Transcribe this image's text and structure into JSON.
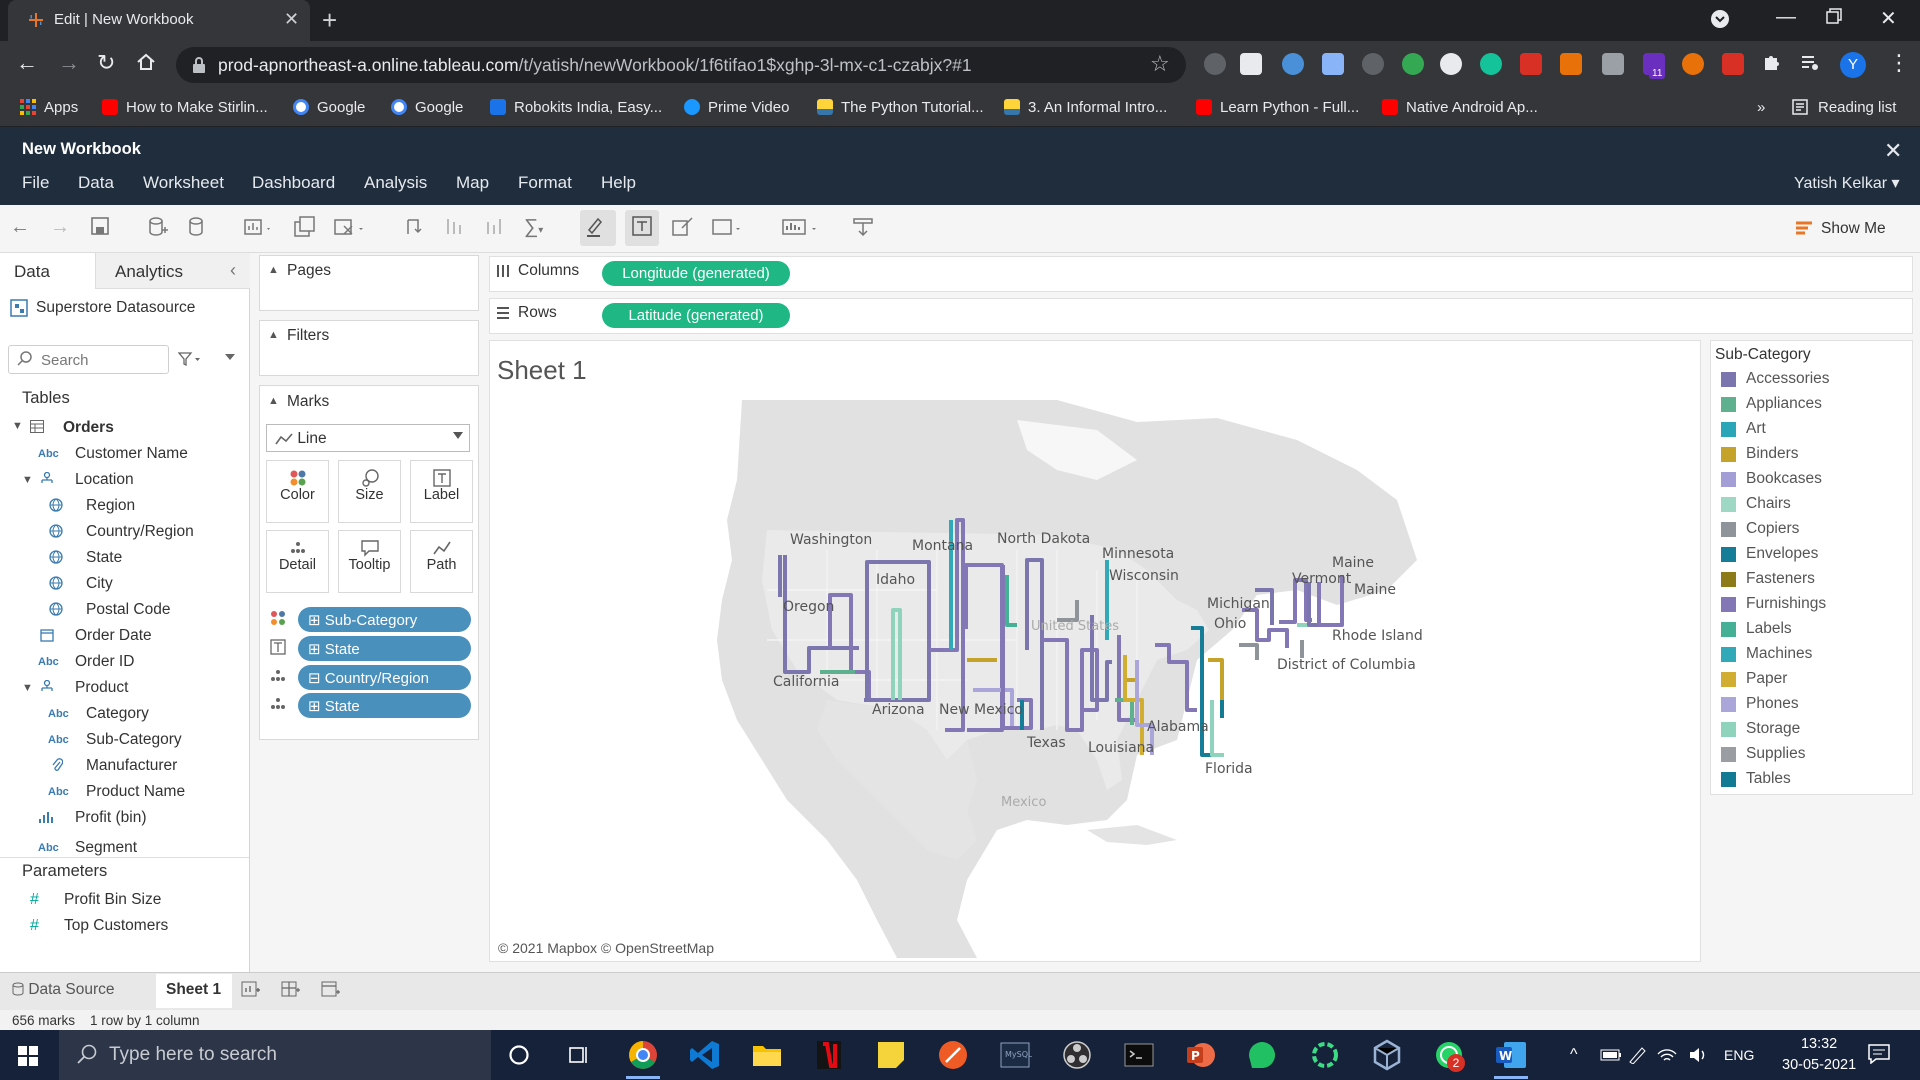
{
  "browser": {
    "tab_title": "Edit | New Workbook",
    "url_host": "prod-apnortheast-a.online.tableau.com",
    "url_path": "/t/yatish/newWorkbook/1f6tifao1$xghp-3l-mx-c1-czabjx?#1",
    "profile_initial": "Y",
    "extensions_badge": "11",
    "bookmarks": [
      "Apps",
      "How to Make Stirlin...",
      "Google",
      "Google",
      "Robokits India, Easy...",
      "Prime Video",
      "The Python Tutorial...",
      "3. An Informal Intro...",
      "Learn Python - Full...",
      "Native Android Ap..."
    ],
    "bookmarks_more": "»",
    "reading_list": "Reading list"
  },
  "tableau": {
    "workbook_title": "New Workbook",
    "menu": [
      "File",
      "Data",
      "Worksheet",
      "Dashboard",
      "Analysis",
      "Map",
      "Format",
      "Help"
    ],
    "user": "Yatish Kelkar ▾",
    "show_me": "Show Me",
    "pane_tabs": {
      "data": "Data",
      "analytics": "Analytics"
    },
    "datasource": "Superstore Datasource",
    "search_placeholder": "Search",
    "tables_header": "Tables",
    "fields": [
      {
        "label": "Orders",
        "type": "table"
      },
      {
        "label": "Customer Name",
        "type": "Abc"
      },
      {
        "label": "Location",
        "type": "hier"
      },
      {
        "label": "Region",
        "type": "geo"
      },
      {
        "label": "Country/Region",
        "type": "geo"
      },
      {
        "label": "State",
        "type": "geo"
      },
      {
        "label": "City",
        "type": "geo"
      },
      {
        "label": "Postal Code",
        "type": "geo"
      },
      {
        "label": "Order Date",
        "type": "date"
      },
      {
        "label": "Order ID",
        "type": "Abc"
      },
      {
        "label": "Product",
        "type": "hier"
      },
      {
        "label": "Category",
        "type": "Abc"
      },
      {
        "label": "Sub-Category",
        "type": "Abc"
      },
      {
        "label": "Manufacturer",
        "type": "clip"
      },
      {
        "label": "Product Name",
        "type": "Abc"
      },
      {
        "label": "Profit (bin)",
        "type": "bin"
      },
      {
        "label": "Segment",
        "type": "Abc"
      }
    ],
    "parameters_header": "Parameters",
    "parameters": [
      "Profit Bin Size",
      "Top Customers"
    ],
    "cards": {
      "pages": "Pages",
      "filters": "Filters",
      "marks": "Marks"
    },
    "mark_type": "Line",
    "mark_buttons": [
      "Color",
      "Size",
      "Label",
      "Detail",
      "Tooltip",
      "Path"
    ],
    "mark_pills": [
      "⊞ Sub-Category",
      "⊞ State",
      "⊟ Country/Region",
      "⊞ State"
    ],
    "columns_label": "Columns",
    "rows_label": "Rows",
    "columns_pill": "Longitude (generated)",
    "rows_pill": "Latitude (generated)",
    "sheet_title": "Sheet 1",
    "map_copyright": "© 2021 Mapbox © OpenStreetMap",
    "map_labels": [
      "Washington",
      "Montana",
      "North Dakota",
      "Minnesota",
      "Wisconsin",
      "Maine",
      "Maine",
      "Vermont",
      "Idaho",
      "Oregon",
      "Michigan",
      "Ohio",
      "Rhode Island",
      "United States",
      "District of Columbia",
      "California",
      "Arizona",
      "New Mexico",
      "Texas",
      "Louisiana",
      "Alabama",
      "Florida",
      "Mexico"
    ],
    "legend_title": "Sub-Category",
    "legend": [
      {
        "label": "Accessories",
        "color": "#7b76ad"
      },
      {
        "label": "Appliances",
        "color": "#5fb08e"
      },
      {
        "label": "Art",
        "color": "#2aa6b8"
      },
      {
        "label": "Binders",
        "color": "#c5a32b"
      },
      {
        "label": "Bookcases",
        "color": "#a39ed6"
      },
      {
        "label": "Chairs",
        "color": "#9ed8c4"
      },
      {
        "label": "Copiers",
        "color": "#8f949a"
      },
      {
        "label": "Envelopes",
        "color": "#157d97"
      },
      {
        "label": "Fasteners",
        "color": "#8c7b18"
      },
      {
        "label": "Furnishings",
        "color": "#8377b6"
      },
      {
        "label": "Labels",
        "color": "#45b096"
      },
      {
        "label": "Machines",
        "color": "#32a9b9"
      },
      {
        "label": "Paper",
        "color": "#d1ad32"
      },
      {
        "label": "Phones",
        "color": "#aaa6da"
      },
      {
        "label": "Storage",
        "color": "#8fd3bd"
      },
      {
        "label": "Supplies",
        "color": "#9a9ea2"
      },
      {
        "label": "Tables",
        "color": "#137a93"
      }
    ],
    "bottom_tabs": {
      "datasource": "Data Source",
      "sheet": "Sheet 1"
    },
    "status": {
      "marks": "656 marks",
      "rows": "1 row by 1 column"
    }
  },
  "taskbar": {
    "search_placeholder": "Type here to search",
    "lang": "ENG",
    "time": "13:32",
    "date": "30-05-2021",
    "whatsapp_badge": "2"
  }
}
